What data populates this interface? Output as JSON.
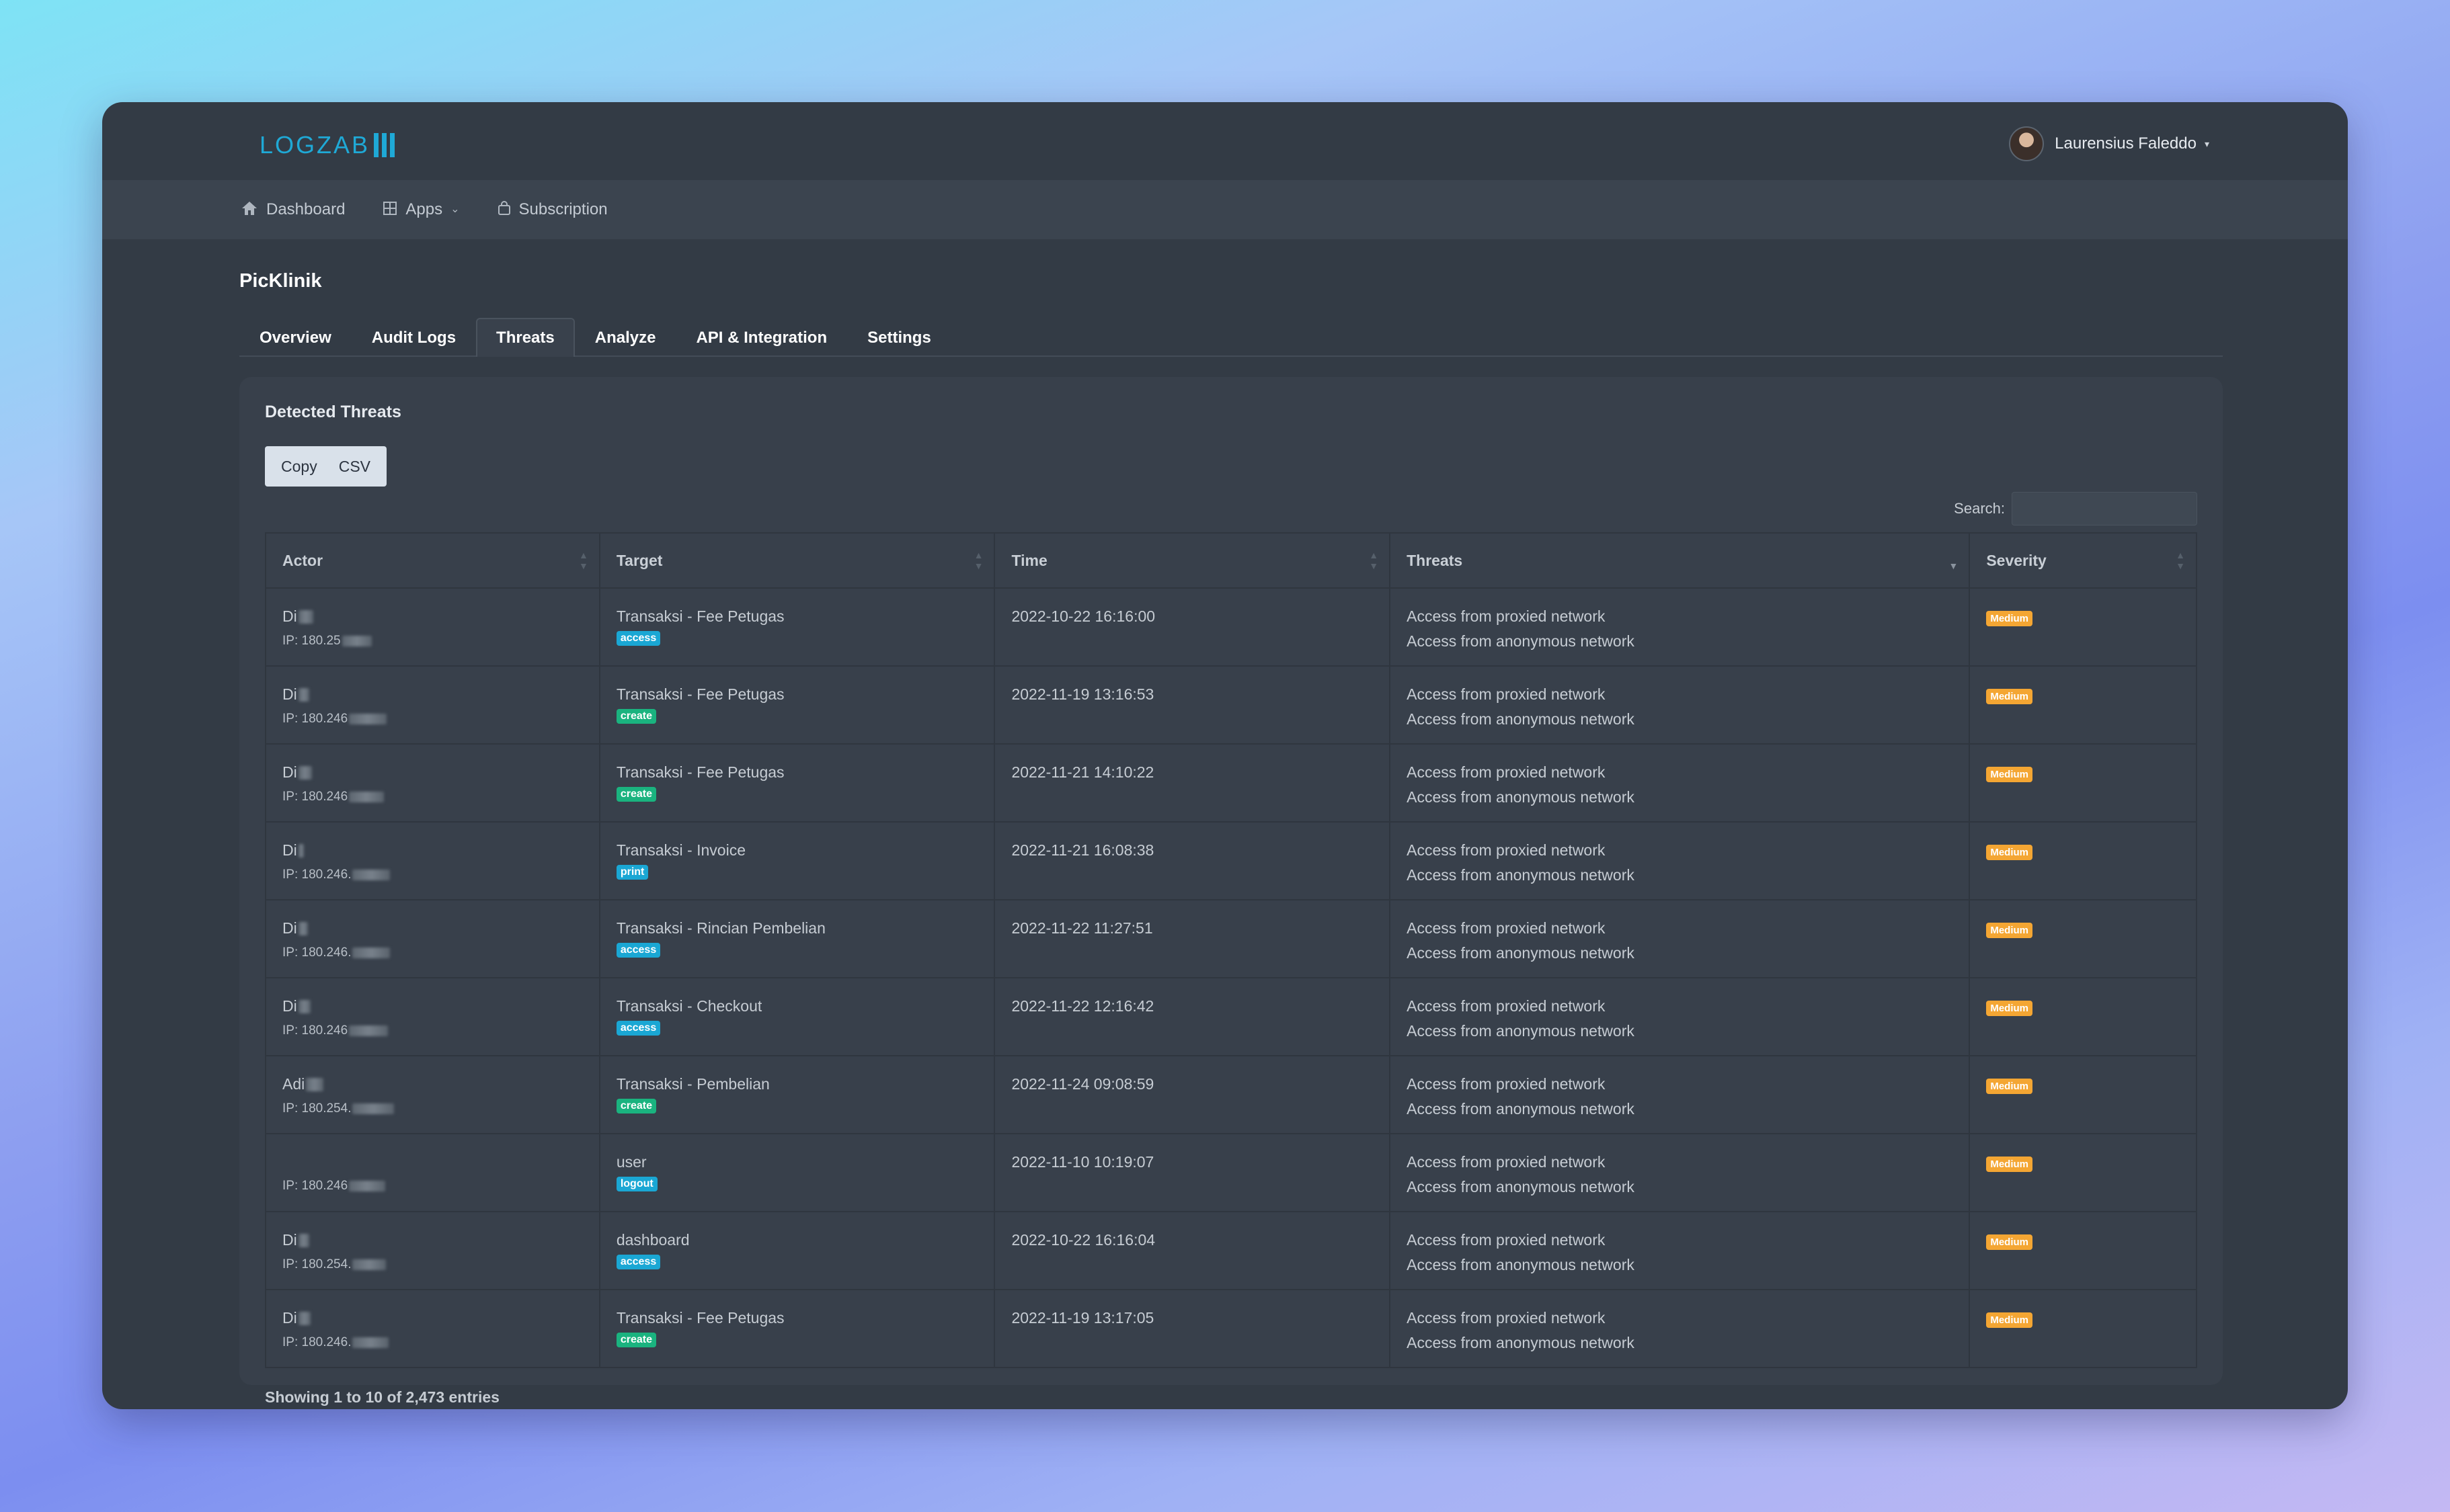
{
  "app": {
    "logo_text": "LOGZAB"
  },
  "user": {
    "name": "Laurensius Faleddo"
  },
  "nav": [
    {
      "label": "Dashboard",
      "icon": "home-icon"
    },
    {
      "label": "Apps",
      "icon": "grid-icon"
    },
    {
      "label": "Subscription",
      "icon": "bag-icon"
    }
  ],
  "page": {
    "title": "PicKlinik"
  },
  "tabs": [
    "Overview",
    "Audit Logs",
    "Threats",
    "Analyze",
    "API & Integration",
    "Settings"
  ],
  "active_tab": "Threats",
  "card": {
    "title": "Detected Threats",
    "buttons": {
      "copy": "Copy",
      "csv": "CSV"
    },
    "search_label": "Search:",
    "search_placeholder": "",
    "info": "Showing 1 to 10 of 2,473 entries"
  },
  "table": {
    "columns": [
      "Actor",
      "Target",
      "Time",
      "Threats",
      "Severity"
    ],
    "rows": [
      {
        "actor": "Di",
        "ip": "IP: 180.25",
        "target": "Transaksi - Fee Petugas",
        "action": "access",
        "time": "2022-10-22 16:16:00",
        "threats": [
          "Access from proxied network",
          "Access from anonymous network"
        ],
        "severity": "Medium"
      },
      {
        "actor": "Di",
        "ip": "IP: 180.246",
        "target": "Transaksi - Fee Petugas",
        "action": "create",
        "time": "2022-11-19 13:16:53",
        "threats": [
          "Access from proxied network",
          "Access from anonymous network"
        ],
        "severity": "Medium"
      },
      {
        "actor": "Di",
        "ip": "IP: 180.246",
        "target": "Transaksi - Fee Petugas",
        "action": "create",
        "time": "2022-11-21 14:10:22",
        "threats": [
          "Access from proxied network",
          "Access from anonymous network"
        ],
        "severity": "Medium"
      },
      {
        "actor": "Di",
        "ip": "IP: 180.246.",
        "target": "Transaksi - Invoice",
        "action": "print",
        "time": "2022-11-21 16:08:38",
        "threats": [
          "Access from proxied network",
          "Access from anonymous network"
        ],
        "severity": "Medium"
      },
      {
        "actor": "Di",
        "ip": "IP: 180.246.",
        "target": "Transaksi - Rincian Pembelian",
        "action": "access",
        "time": "2022-11-22 11:27:51",
        "threats": [
          "Access from proxied network",
          "Access from anonymous network"
        ],
        "severity": "Medium"
      },
      {
        "actor": "Di",
        "ip": "IP: 180.246",
        "target": "Transaksi - Checkout",
        "action": "access",
        "time": "2022-11-22 12:16:42",
        "threats": [
          "Access from proxied network",
          "Access from anonymous network"
        ],
        "severity": "Medium"
      },
      {
        "actor": "Adi",
        "ip": "IP: 180.254.",
        "target": "Transaksi - Pembelian",
        "action": "create",
        "time": "2022-11-24 09:08:59",
        "threats": [
          "Access from proxied network",
          "Access from anonymous network"
        ],
        "severity": "Medium"
      },
      {
        "actor": "",
        "ip": "IP: 180.246",
        "target": "user",
        "action": "logout",
        "time": "2022-11-10 10:19:07",
        "threats": [
          "Access from proxied network",
          "Access from anonymous network"
        ],
        "severity": "Medium"
      },
      {
        "actor": "Di",
        "ip": "IP: 180.254.",
        "target": "dashboard",
        "action": "access",
        "time": "2022-10-22 16:16:04",
        "threats": [
          "Access from proxied network",
          "Access from anonymous network"
        ],
        "severity": "Medium"
      },
      {
        "actor": "Di",
        "ip": "IP: 180.246.",
        "target": "Transaksi - Fee Petugas",
        "action": "create",
        "time": "2022-11-19 13:17:05",
        "threats": [
          "Access from proxied network",
          "Access from anonymous network"
        ],
        "severity": "Medium"
      }
    ]
  },
  "colors": {
    "accent": "#1fa9d6",
    "access": "#1aa7d4",
    "create": "#1ab37f",
    "medium": "#f4a633"
  }
}
